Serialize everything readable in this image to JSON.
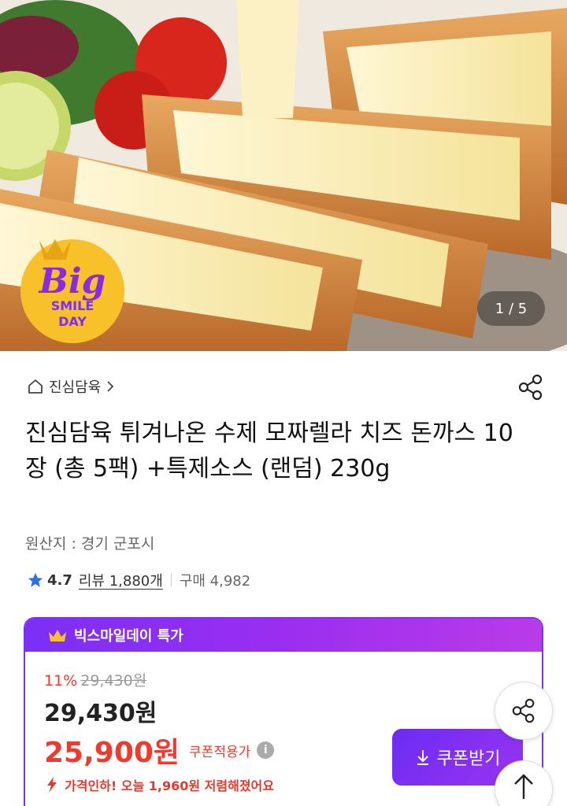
{
  "hero": {
    "image_desc": "cheese-cutlet-photo",
    "counter": "1 / 5",
    "badge": {
      "line1": "Big",
      "line2": "SMILE",
      "line3": "DAY"
    }
  },
  "breadcrumb": {
    "store": "진심담육"
  },
  "product": {
    "title": "진심담육 튀겨나온 수제 모짜렐라 치즈 돈까스 10장 (총 5팩) +특제소스 (랜덤) 230g",
    "origin": "원산지 : 경기 군포시",
    "rating": "4.7",
    "review_label": "리뷰 1,880개",
    "purchase_label": "구매 4,982"
  },
  "promo": {
    "header": "빅스마일데이 특가",
    "discount_rate": "11%",
    "original_price": "29,430원",
    "price": "29,430원",
    "coupon_price": "25,900원",
    "coupon_label": "쿠폰적용가",
    "price_drop": "가격인하! 오늘 1,960원 저렴해졌어요",
    "coupon_button": "쿠폰받기"
  },
  "colors": {
    "accent_purple": "#7b2ff7",
    "price_red": "#f03a2e"
  }
}
